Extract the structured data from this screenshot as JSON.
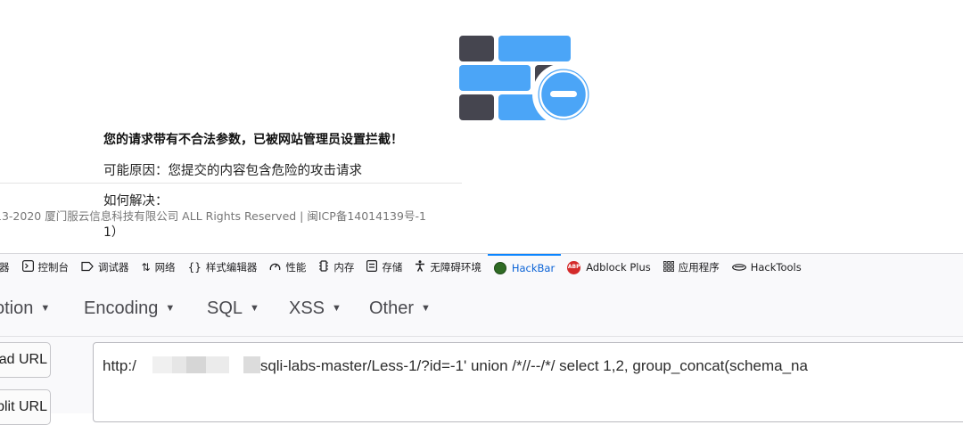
{
  "waf_page": {
    "title": "您的请求带有不合法参数，已被网站管理员设置拦截！",
    "reason": "可能原因：您提交的内容包含危险的攻击请求",
    "how_to": "如何解决：",
    "copyright": "13-2020 厦门服云信息科技有限公司 ALL Rights Reserved | 闽ICP备14014139号-1",
    "extra": "1）",
    "colors": {
      "brick_dark": "#45454f",
      "brick_blue": "#4ba5f7"
    }
  },
  "devtools": {
    "tabs": [
      {
        "label": "器",
        "icon": "inspector-icon"
      },
      {
        "label": "控制台",
        "icon": "console-icon"
      },
      {
        "label": "调试器",
        "icon": "debugger-icon"
      },
      {
        "label": "网络",
        "icon": "network-icon"
      },
      {
        "label": "样式编辑器",
        "icon": "style-editor-icon"
      },
      {
        "label": "性能",
        "icon": "performance-icon"
      },
      {
        "label": "内存",
        "icon": "memory-icon"
      },
      {
        "label": "存储",
        "icon": "storage-icon"
      },
      {
        "label": "无障碍环境",
        "icon": "accessibility-icon"
      },
      {
        "label": "HackBar",
        "icon": "hackbar-icon",
        "active": true
      },
      {
        "label": "Adblock Plus",
        "icon": "adblock-plus-icon"
      },
      {
        "label": "应用程序",
        "icon": "application-grid-icon"
      },
      {
        "label": "HackTools",
        "icon": "hacktools-icon"
      }
    ],
    "active_color": "#0a84ff"
  },
  "hackbar": {
    "menu": [
      "otion",
      "Encoding",
      "SQL",
      "XSS",
      "Other"
    ],
    "buttons": [
      "ad URL",
      "plit URL"
    ],
    "url_prefix": "http:/",
    "url_suffix": "sqli-labs-master/Less-1/?id=-1' union /*//--/*/ select 1,2, group_concat(schema_na"
  }
}
